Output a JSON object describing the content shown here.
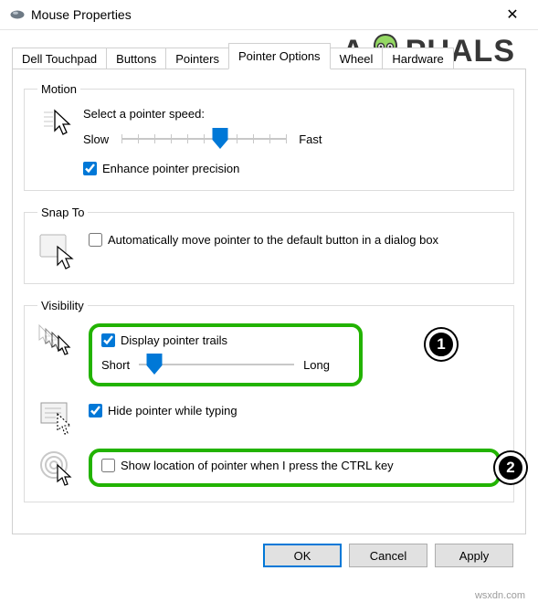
{
  "window": {
    "title": "Mouse Properties",
    "close_glyph": "✕"
  },
  "tabs": {
    "items": [
      {
        "label": "Dell Touchpad"
      },
      {
        "label": "Buttons"
      },
      {
        "label": "Pointers"
      },
      {
        "label": "Pointer Options"
      },
      {
        "label": "Wheel"
      },
      {
        "label": "Hardware"
      }
    ],
    "active_index": 3
  },
  "motion": {
    "legend": "Motion",
    "select_speed": "Select a pointer speed:",
    "slow": "Slow",
    "fast": "Fast",
    "speed_value": 6,
    "speed_min": 0,
    "speed_max": 10,
    "enhance_checked": true,
    "enhance_label": "Enhance pointer precision"
  },
  "snap": {
    "legend": "Snap To",
    "auto_checked": false,
    "auto_label": "Automatically move pointer to the default button in a dialog box"
  },
  "visibility": {
    "legend": "Visibility",
    "trails_checked": true,
    "trails_label": "Display pointer trails",
    "short": "Short",
    "long": "Long",
    "trails_value": 1,
    "trails_min": 0,
    "trails_max": 10,
    "hide_checked": true,
    "hide_label": "Hide pointer while typing",
    "ctrl_checked": false,
    "ctrl_label": "Show location of pointer when I press the CTRL key"
  },
  "callouts": {
    "one": "1",
    "two": "2"
  },
  "buttons": {
    "ok": "OK",
    "cancel": "Cancel",
    "apply": "Apply"
  },
  "watermark": {
    "left": "A",
    "right": "PUALS"
  },
  "footer": "wsxdn.com"
}
